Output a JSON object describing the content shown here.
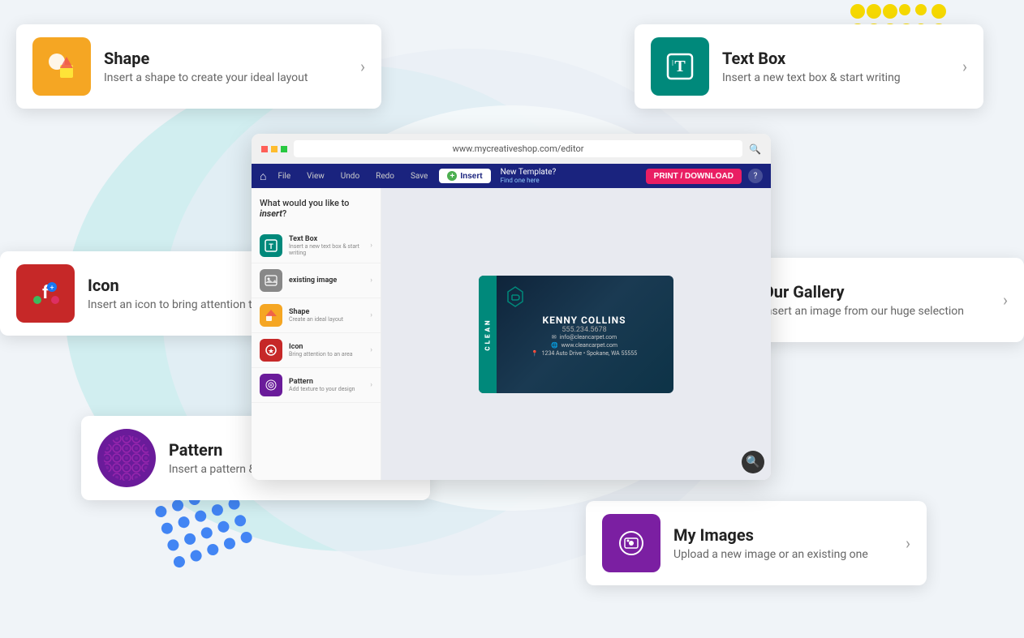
{
  "browser": {
    "url": "www.mycreativeshop.com/editor",
    "toolbar": {
      "home_icon": "🏠",
      "file_label": "File",
      "view_label": "View",
      "undo_label": "Undo",
      "redo_label": "Redo",
      "save_label": "Save",
      "insert_label": "Insert",
      "template_label": "New Template?",
      "find_label": "Find one here",
      "print_label": "PRINT / DOWNLOAD",
      "help_label": "?"
    },
    "sidebar": {
      "question": "What would you like to insert?",
      "items": [
        {
          "label": "Text Box",
          "desc": "Insert a new text box & start writing",
          "color": "#00897b"
        },
        {
          "label": "existing image",
          "desc": "",
          "color": "#888"
        },
        {
          "label": "Shape",
          "desc": "Create an ideal layout",
          "color": "#f5a623"
        },
        {
          "label": "Icon",
          "desc": "Bring attention to an area",
          "color": "#c62828"
        },
        {
          "label": "Pattern",
          "desc": "Add texture to your design",
          "color": "#6a1b9a"
        }
      ]
    },
    "biz_card": {
      "name": "KENNY COLLINS",
      "phone": "555.234.5678",
      "email": "info@cleancarpet.com",
      "website": "www.cleancarpet.com",
      "address": "1234 Auto Drive • Spokane, WA 55555",
      "side_text": "CLEAN"
    }
  },
  "cards": {
    "shape": {
      "title": "Shape",
      "desc": "Insert a shape to create your ideal layout",
      "icon_bg": "#f5a623"
    },
    "textbox": {
      "title": "Text Box",
      "desc": "Insert a new text box & start writing",
      "icon_bg": "#00897b"
    },
    "icon_item": {
      "title": "Icon",
      "desc": "Insert an icon to bring attention to an area",
      "icon_bg": "#c62828"
    },
    "gallery": {
      "title": "Our Gallery",
      "desc": "Insert an image from our huge selection",
      "icon_bg": "#4a6fa5"
    },
    "pattern": {
      "title": "Pattern",
      "desc": "Insert a pattern & add texture",
      "icon_bg": "#6a1b9a"
    },
    "myimages": {
      "title": "My Images",
      "desc": "Upload a new image or an existing one",
      "icon_bg": "#7b1fa2"
    }
  },
  "dots": {
    "yellow_count": 24,
    "blue_count": 20
  }
}
